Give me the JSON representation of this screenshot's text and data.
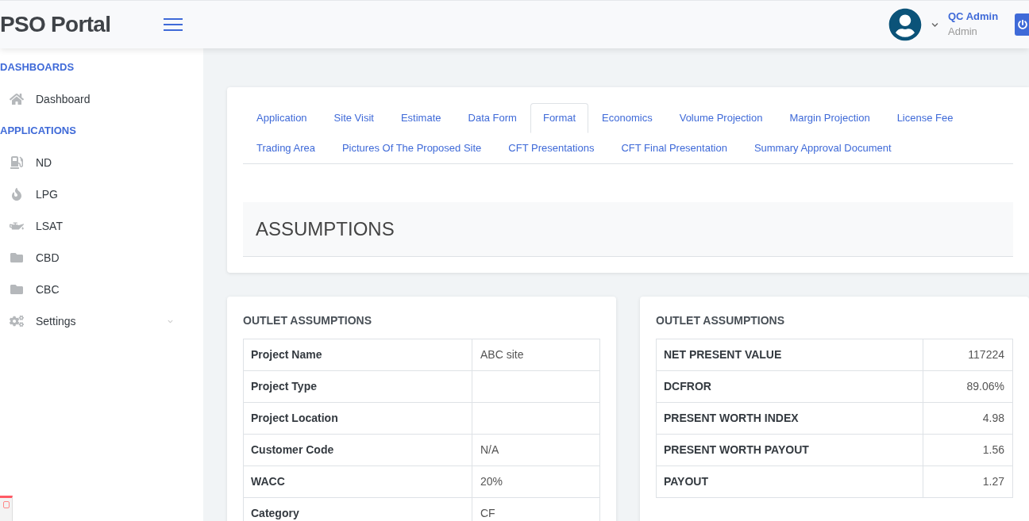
{
  "header": {
    "title": "PSO Portal",
    "user": {
      "name": "QC Admin",
      "role": "Admin"
    }
  },
  "sidebar": {
    "sections": [
      {
        "heading": "DASHBOARDS",
        "items": [
          {
            "label": "Dashboard",
            "kind": "home"
          }
        ]
      },
      {
        "heading": "APPLICATIONS",
        "items": [
          {
            "label": "ND",
            "kind": "fuel"
          },
          {
            "label": "LPG",
            "kind": "flame"
          },
          {
            "label": "LSAT",
            "kind": "oil"
          },
          {
            "label": "CBD",
            "kind": "folder"
          },
          {
            "label": "CBC",
            "kind": "folder"
          },
          {
            "label": "Settings",
            "kind": "gears",
            "expandable": true
          }
        ]
      }
    ]
  },
  "tabs": [
    {
      "label": "Application",
      "selected": false
    },
    {
      "label": "Site Visit",
      "selected": false
    },
    {
      "label": "Estimate",
      "selected": false
    },
    {
      "label": "Data Form",
      "selected": false
    },
    {
      "label": "Format",
      "selected": true
    },
    {
      "label": "Economics",
      "selected": false
    },
    {
      "label": "Volume Projection",
      "selected": false
    },
    {
      "label": "Margin Projection",
      "selected": false
    },
    {
      "label": "License Fee",
      "selected": false
    },
    {
      "label": "Trading Area",
      "selected": false
    },
    {
      "label": "Pictures Of The Proposed Site",
      "selected": false
    },
    {
      "label": "CFT Presentations",
      "selected": false
    },
    {
      "label": "CFT Final Presentation",
      "selected": false
    },
    {
      "label": "Summary Approval Document",
      "selected": false
    }
  ],
  "page_heading": "ASSUMPTIONS",
  "panels": [
    {
      "title": "OUTLET ASSUMPTIONS",
      "kind": "details",
      "rows": [
        [
          "Project Name",
          "ABC site"
        ],
        [
          "Project Type",
          ""
        ],
        [
          "Project Location",
          ""
        ],
        [
          "Customer Code",
          "N/A"
        ],
        [
          "WACC",
          "20%"
        ],
        [
          "Category",
          "CF"
        ]
      ]
    },
    {
      "title": "OUTLET ASSUMPTIONS",
      "kind": "metrics",
      "rows": [
        [
          "NET PRESENT VALUE",
          "117224"
        ],
        [
          "DCFROR",
          "89.06%"
        ],
        [
          "PRESENT WORTH INDEX",
          "4.98"
        ],
        [
          "PRESENT WORTH PAYOUT",
          "1.56"
        ],
        [
          "PAYOUT",
          "1.27"
        ]
      ]
    }
  ]
}
